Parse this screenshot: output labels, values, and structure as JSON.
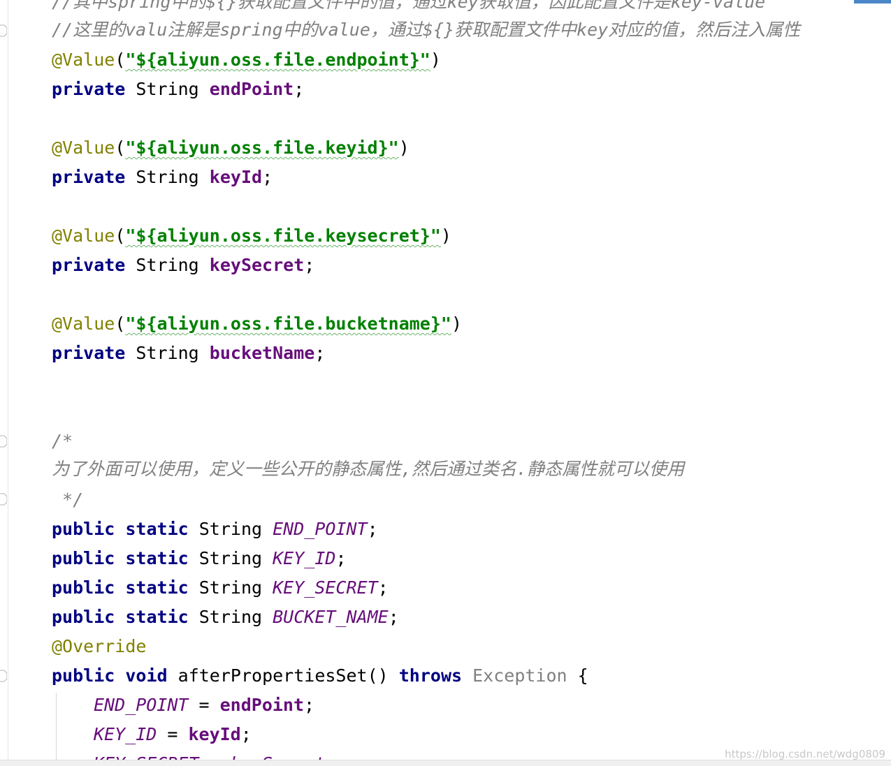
{
  "code": {
    "line_0": "//其中spring中的${}获取配置文件中的值，通过key获取值，因此配置文件是key-value",
    "line_1": "//这里的valu注解是spring中的value，通过${}获取配置文件中key对应的值，然后注入属性",
    "annotations": {
      "value": "@Value",
      "override": "@Override"
    },
    "values": [
      "\"${aliyun.oss.file.endpoint}\"",
      "\"${aliyun.oss.file.keyid}\"",
      "\"${aliyun.oss.file.keysecret}\"",
      "\"${aliyun.oss.file.bucketname}\""
    ],
    "kw_private": "private",
    "kw_public": "public",
    "kw_static": "static",
    "kw_void": "void",
    "kw_throws": "throws",
    "type_string": "String",
    "fields": [
      "endPoint",
      "keyId",
      "keySecret",
      "bucketName"
    ],
    "comment_open": "/*",
    "comment_body": "为了外面可以使用，定义一些公开的静态属性,然后通过类名.静态属性就可以使用",
    "comment_close": " */",
    "static_fields": [
      "END_POINT",
      "KEY_ID",
      "KEY_SECRET",
      "BUCKET_NAME"
    ],
    "method_name": "afterPropertiesSet",
    "exception_type": "Exception",
    "assign_1_left": "END_POINT",
    "assign_1_right": "endPoint",
    "assign_2_left": "KEY_ID",
    "assign_2_right": "keyId",
    "assign_3_partial": "KEY_SECRET = keySecret;"
  },
  "watermark": "https://blog.csdn.net/wdg0809"
}
